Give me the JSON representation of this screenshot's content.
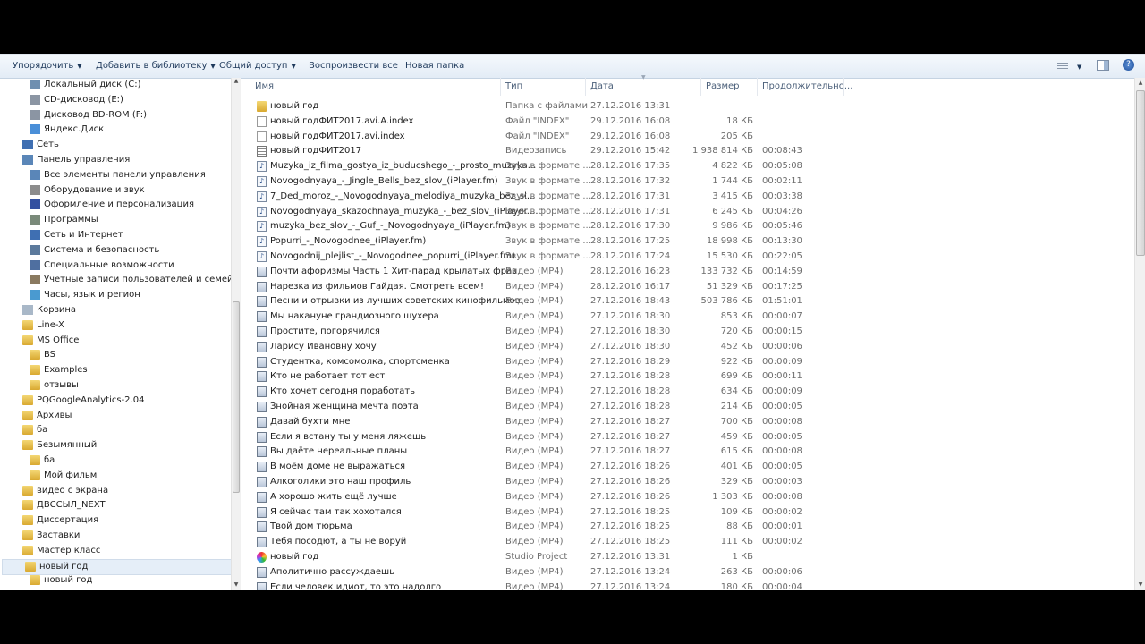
{
  "toolbar": {
    "organize": "Упорядочить",
    "add_to_library": "Добавить в библиотеку",
    "share": "Общий доступ",
    "play_all": "Воспроизвести все",
    "new_folder": "Новая папка"
  },
  "nav": [
    {
      "label": "Локальный диск (C:)",
      "level": 2,
      "icon": "drive"
    },
    {
      "label": "CD-дисковод (E:)",
      "level": 2,
      "icon": "cd-drive"
    },
    {
      "label": "Дисковод BD-ROM (F:)",
      "level": 2,
      "icon": "cd-drive"
    },
    {
      "label": "Яндекс.Диск",
      "level": 2,
      "icon": "cloud"
    },
    {
      "label": "Сеть",
      "level": 1,
      "icon": "network"
    },
    {
      "label": "Панель управления",
      "level": 1,
      "icon": "control-panel"
    },
    {
      "label": "Все элементы панели управления",
      "level": 2,
      "icon": "control-panel"
    },
    {
      "label": "Оборудование и звук",
      "level": 2,
      "icon": "printer"
    },
    {
      "label": "Оформление и персонализация",
      "level": 2,
      "icon": "display"
    },
    {
      "label": "Программы",
      "level": 2,
      "icon": "programs"
    },
    {
      "label": "Сеть и Интернет",
      "level": 2,
      "icon": "network"
    },
    {
      "label": "Система и безопасность",
      "level": 2,
      "icon": "shield"
    },
    {
      "label": "Специальные возможности",
      "level": 2,
      "icon": "accessibility"
    },
    {
      "label": "Учетные записи пользователей и семейная без",
      "level": 2,
      "icon": "users"
    },
    {
      "label": "Часы, язык и регион",
      "level": 2,
      "icon": "clock"
    },
    {
      "label": "Корзина",
      "level": 1,
      "icon": "recycle-bin"
    },
    {
      "label": "Line-X",
      "level": 1,
      "icon": "folder"
    },
    {
      "label": "MS Office",
      "level": 1,
      "icon": "folder"
    },
    {
      "label": "BS",
      "level": 2,
      "icon": "folder"
    },
    {
      "label": "Examples",
      "level": 2,
      "icon": "folder"
    },
    {
      "label": "отзывы",
      "level": 2,
      "icon": "folder"
    },
    {
      "label": "PQGoogleAnalytics-2.04",
      "level": 1,
      "icon": "folder"
    },
    {
      "label": "Архивы",
      "level": 1,
      "icon": "folder"
    },
    {
      "label": "ба",
      "level": 1,
      "icon": "folder"
    },
    {
      "label": "Безымянный",
      "level": 1,
      "icon": "folder"
    },
    {
      "label": "ба",
      "level": 2,
      "icon": "folder"
    },
    {
      "label": "Мой фильм",
      "level": 2,
      "icon": "folder"
    },
    {
      "label": "видео с экрана",
      "level": 1,
      "icon": "folder"
    },
    {
      "label": "ДВССЫЛ_NEXT",
      "level": 1,
      "icon": "folder"
    },
    {
      "label": "Диссертация",
      "level": 1,
      "icon": "folder"
    },
    {
      "label": "Заставки",
      "level": 1,
      "icon": "folder"
    },
    {
      "label": "Мастер класс",
      "level": 1,
      "icon": "folder"
    },
    {
      "label": "новый год",
      "level": 1,
      "icon": "folder",
      "selected": true
    },
    {
      "label": "новый год",
      "level": 2,
      "icon": "folder"
    }
  ],
  "columns": {
    "name": "Имя",
    "type": "Тип",
    "date": "Дата",
    "size": "Размер",
    "duration": "Продолжительно..."
  },
  "files": [
    {
      "name": "новый год",
      "type": "Папка с файлами",
      "date": "27.12.2016 13:31",
      "size": "",
      "duration": "",
      "icon": "folder"
    },
    {
      "name": "новый годФИТ2017.avi.A.index",
      "type": "Файл \"INDEX\"",
      "date": "29.12.2016 16:08",
      "size": "18 КБ",
      "duration": "",
      "icon": "file"
    },
    {
      "name": "новый годФИТ2017.avi.index",
      "type": "Файл \"INDEX\"",
      "date": "29.12.2016 16:08",
      "size": "205 КБ",
      "duration": "",
      "icon": "file"
    },
    {
      "name": "новый годФИТ2017",
      "type": "Видеозапись",
      "date": "29.12.2016 15:42",
      "size": "1 938 814 КБ",
      "duration": "00:08:43",
      "icon": "vrec"
    },
    {
      "name": "Muzyka_iz_filma_gostya_iz_buducshego_-_prosto_muzyka...",
      "type": "Звук в формате ...",
      "date": "28.12.2016 17:35",
      "size": "4 822 КБ",
      "duration": "00:05:08",
      "icon": "audio"
    },
    {
      "name": "Novogodnyaya_-_Jingle_Bells_bez_slov_(iPlayer.fm)",
      "type": "Звук в формате ...",
      "date": "28.12.2016 17:32",
      "size": "1 744 КБ",
      "duration": "00:02:11",
      "icon": "audio"
    },
    {
      "name": "7_Ded_moroz_-_Novogodnyaya_melodiya_muzyka_bez_sl...",
      "type": "Звук в формате ...",
      "date": "28.12.2016 17:31",
      "size": "3 415 КБ",
      "duration": "00:03:38",
      "icon": "audio"
    },
    {
      "name": "Novogodnyaya_skazochnaya_muzyka_-_bez_slov_(iPlayer....",
      "type": "Звук в формате ...",
      "date": "28.12.2016 17:31",
      "size": "6 245 КБ",
      "duration": "00:04:26",
      "icon": "audio"
    },
    {
      "name": "muzyka_bez_slov_-_Guf_-_Novogodnyaya_(iPlayer.fm)",
      "type": "Звук в формате ...",
      "date": "28.12.2016 17:30",
      "size": "9 986 КБ",
      "duration": "00:05:46",
      "icon": "audio"
    },
    {
      "name": "Popurri_-_Novogodnee_(iPlayer.fm)",
      "type": "Звук в формате ...",
      "date": "28.12.2016 17:25",
      "size": "18 998 КБ",
      "duration": "00:13:30",
      "icon": "audio"
    },
    {
      "name": "Novogodnij_plejlist_-_Novogodnee_popurri_(iPlayer.fm)",
      "type": "Звук в формате ...",
      "date": "28.12.2016 17:24",
      "size": "15 530 КБ",
      "duration": "00:22:05",
      "icon": "audio"
    },
    {
      "name": "Почти афоризмы Часть 1  Хит-парад крылатых фраз",
      "type": "Видео (MP4)",
      "date": "28.12.2016 16:23",
      "size": "133 732 КБ",
      "duration": "00:14:59",
      "icon": "video"
    },
    {
      "name": "Нарезка из фильмов Гайдая. Смотреть всем!",
      "type": "Видео (MP4)",
      "date": "28.12.2016 16:17",
      "size": "51 329 КБ",
      "duration": "00:17:25",
      "icon": "video"
    },
    {
      "name": "Песни и отрывки из лучших советских кинофильмов. ...",
      "type": "Видео (MP4)",
      "date": "27.12.2016 18:43",
      "size": "503 786 КБ",
      "duration": "01:51:01",
      "icon": "video"
    },
    {
      "name": "Мы накануне грандиозного шухера",
      "type": "Видео (MP4)",
      "date": "27.12.2016 18:30",
      "size": "853 КБ",
      "duration": "00:00:07",
      "icon": "video"
    },
    {
      "name": "Простите, погорячился",
      "type": "Видео (MP4)",
      "date": "27.12.2016 18:30",
      "size": "720 КБ",
      "duration": "00:00:15",
      "icon": "video"
    },
    {
      "name": "Ларису Ивановну хочу",
      "type": "Видео (MP4)",
      "date": "27.12.2016 18:30",
      "size": "452 КБ",
      "duration": "00:00:06",
      "icon": "video"
    },
    {
      "name": "Студентка, комсомолка, спортсменка",
      "type": "Видео (MP4)",
      "date": "27.12.2016 18:29",
      "size": "922 КБ",
      "duration": "00:00:09",
      "icon": "video"
    },
    {
      "name": "Кто не работает тот ест",
      "type": "Видео (MP4)",
      "date": "27.12.2016 18:28",
      "size": "699 КБ",
      "duration": "00:00:11",
      "icon": "video"
    },
    {
      "name": "Кто хочет сегодня поработать",
      "type": "Видео (MP4)",
      "date": "27.12.2016 18:28",
      "size": "634 КБ",
      "duration": "00:00:09",
      "icon": "video"
    },
    {
      "name": "Знойная женщина мечта поэта",
      "type": "Видео (MP4)",
      "date": "27.12.2016 18:28",
      "size": "214 КБ",
      "duration": "00:00:05",
      "icon": "video"
    },
    {
      "name": "Давай бухти мне",
      "type": "Видео (MP4)",
      "date": "27.12.2016 18:27",
      "size": "700 КБ",
      "duration": "00:00:08",
      "icon": "video"
    },
    {
      "name": "Если я встану ты у меня ляжешь",
      "type": "Видео (MP4)",
      "date": "27.12.2016 18:27",
      "size": "459 КБ",
      "duration": "00:00:05",
      "icon": "video"
    },
    {
      "name": "Вы даёте нереальные планы",
      "type": "Видео (MP4)",
      "date": "27.12.2016 18:27",
      "size": "615 КБ",
      "duration": "00:00:08",
      "icon": "video"
    },
    {
      "name": "В моём доме не выражаться",
      "type": "Видео (MP4)",
      "date": "27.12.2016 18:26",
      "size": "401 КБ",
      "duration": "00:00:05",
      "icon": "video"
    },
    {
      "name": "Алкоголики это наш профиль",
      "type": "Видео (MP4)",
      "date": "27.12.2016 18:26",
      "size": "329 КБ",
      "duration": "00:00:03",
      "icon": "video"
    },
    {
      "name": "А хорошо жить ещё лучше",
      "type": "Видео (MP4)",
      "date": "27.12.2016 18:26",
      "size": "1 303 КБ",
      "duration": "00:00:08",
      "icon": "video"
    },
    {
      "name": "Я сейчас там так хохотался",
      "type": "Видео (MP4)",
      "date": "27.12.2016 18:25",
      "size": "109 КБ",
      "duration": "00:00:02",
      "icon": "video"
    },
    {
      "name": "Твой дом тюрьма",
      "type": "Видео (MP4)",
      "date": "27.12.2016 18:25",
      "size": "88 КБ",
      "duration": "00:00:01",
      "icon": "video"
    },
    {
      "name": "Тебя посодют, а ты не воруй",
      "type": "Видео (MP4)",
      "date": "27.12.2016 18:25",
      "size": "111 КБ",
      "duration": "00:00:02",
      "icon": "video"
    },
    {
      "name": "новый год",
      "type": "Studio Project",
      "date": "27.12.2016 13:31",
      "size": "1 КБ",
      "duration": "",
      "icon": "proj"
    },
    {
      "name": "Аполитично рассуждаешь",
      "type": "Видео (MP4)",
      "date": "27.12.2016 13:24",
      "size": "263 КБ",
      "duration": "00:00:06",
      "icon": "video"
    },
    {
      "name": "Если человек идиот, то это надолго",
      "type": "Видео (MP4)",
      "date": "27.12.2016 13:24",
      "size": "180 КБ",
      "duration": "00:00:04",
      "icon": "video"
    }
  ]
}
